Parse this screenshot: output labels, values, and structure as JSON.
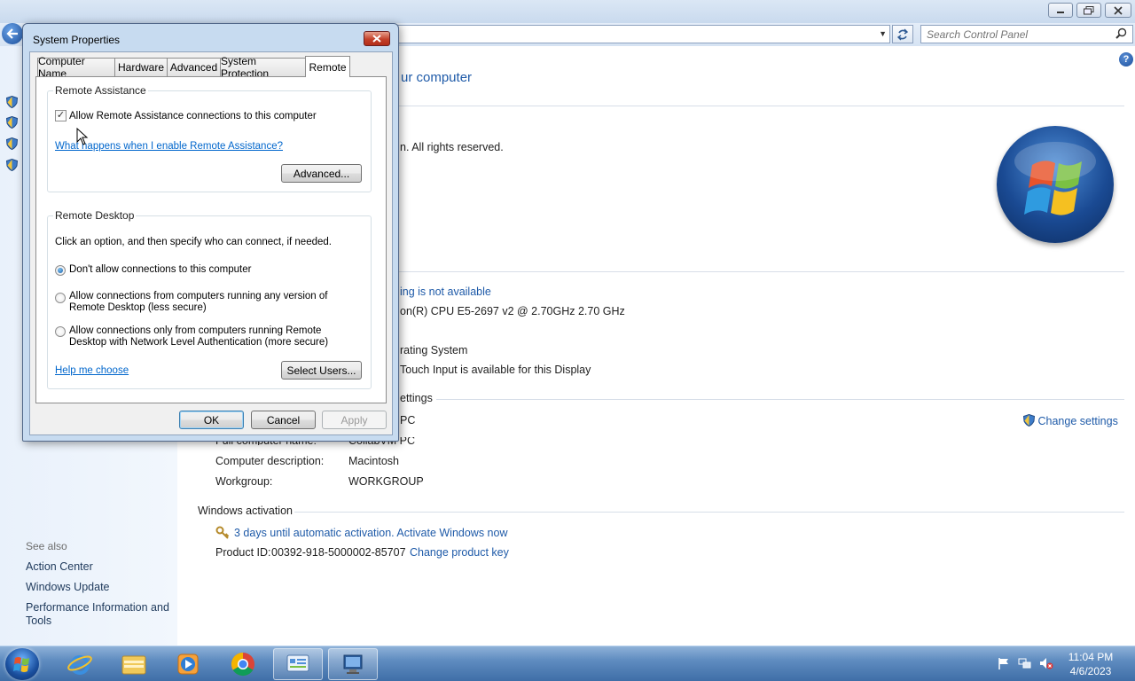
{
  "control_panel": {
    "search_placeholder": "Search Control Panel",
    "heading_fragment": "ur computer",
    "copyright_fragment": "n.  All rights reserved.",
    "pen_touch_fragment": "ing is not available",
    "processor_fragment": "on(R) CPU E5-2697 v2 @ 2.70GHz   2.70 GHz",
    "system_type_fragment": "rating System",
    "touch_fragment": "Touch Input is available for this Display",
    "settings_fragment": "ettings",
    "computer_name_fragment": "PC",
    "full_name_label_fragment": "Full computer name:",
    "full_name_value_fragment": "CollabVM PC",
    "computer_description_label": "Computer description:",
    "computer_description_value": "Macintosh",
    "workgroup_label": "Workgroup:",
    "workgroup_value": "WORKGROUP",
    "change_settings": "Change settings",
    "windows_activation": "Windows activation",
    "activation_status": "3 days until automatic activation. Activate Windows now",
    "product_id_label": "Product ID:",
    "product_id_value": "00392-918-5000002-85707",
    "change_product_key": "Change product key",
    "see_also": "See also",
    "see_also_links": [
      "Action Center",
      "Windows Update",
      "Performance Information and Tools"
    ]
  },
  "dialog": {
    "title": "System Properties",
    "tabs": [
      "Computer Name",
      "Hardware",
      "Advanced",
      "System Protection",
      "Remote"
    ],
    "active_tab": "Remote",
    "remote_assistance": {
      "group_label": "Remote Assistance",
      "allow_checkbox_label": "Allow Remote Assistance connections to this computer",
      "allow_checked": true,
      "help_link": "What happens when I enable Remote Assistance?",
      "advanced_button": "Advanced..."
    },
    "remote_desktop": {
      "group_label": "Remote Desktop",
      "instruction": "Click an option, and then specify who can connect, if needed.",
      "option_dont_allow": "Don't allow connections to this computer",
      "option_any_line1": "Allow connections from computers running any version of",
      "option_any_line2": "Remote Desktop (less secure)",
      "option_nla_line1": "Allow connections only from computers running Remote",
      "option_nla_line2": "Desktop with Network Level Authentication (more secure)",
      "selected_option": "Don't allow connections to this computer",
      "help_me_choose": "Help me choose",
      "select_users_button": "Select Users..."
    },
    "ok_button": "OK",
    "cancel_button": "Cancel",
    "apply_button": "Apply"
  },
  "taskbar": {
    "time": "11:04 PM",
    "date": "4/6/2023"
  },
  "colors": {
    "link": "#1e5aa8",
    "dialog_frame": "#c7dbf0",
    "taskbar": "#5f8cc0"
  }
}
